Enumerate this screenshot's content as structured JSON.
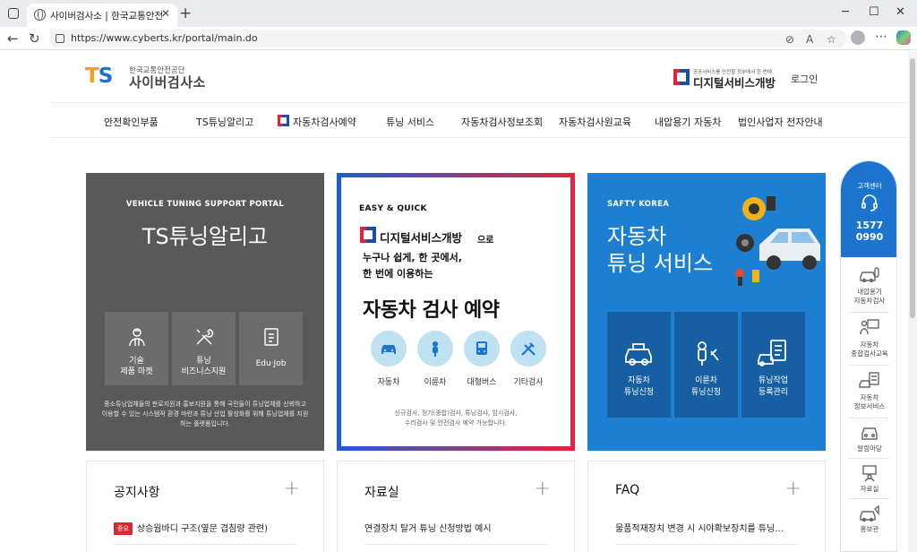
{
  "browser": {
    "tab_title": "사이버검사소 | 한국교통안전공단",
    "url": "https://www.cyberts.kr/portal/main.do"
  },
  "header": {
    "logo_mark_ts": "TS",
    "logo_sub": "한국교통안전공단",
    "logo_main": "사이버검사소",
    "digital_sub": "공공서비스를 안전할 정부에서 한 번에",
    "digital_title": "디지털서비스개방",
    "login": "로그인"
  },
  "nav": [
    "안전확인부품",
    "TS튜닝알리고",
    "자동차검사예약",
    "튜닝 서비스",
    "자동차검사정보조회",
    "자동차검사원교육",
    "내압용기 자동차",
    "법인사업자 전자안내"
  ],
  "card_tuning": {
    "eyebrow": "VEHICLE TUNING SUPPORT PORTAL",
    "title": "TS튜닝알리고",
    "tiles": [
      {
        "label1": "기술",
        "label2": "제품 마켓"
      },
      {
        "label1": "튜닝",
        "label2": "비즈니스지원"
      },
      {
        "label1": "Edu·Job",
        "label2": ""
      }
    ],
    "desc": "중소튜닝업체들의 판로지원과 홍보지원을 통해 국민들이 튜닝업체를 신뢰하고 이용할 수 있는 시스템적 환경 마련과 튜닝 산업 활성화를 위해 튜닝업체를 지원하는 플랫폼입니다."
  },
  "card_reservation": {
    "eyebrow": "EASY & QUICK",
    "brand": "디지털서비스개방",
    "brand_suffix": "으로",
    "line1": "누구나 쉽게, 한 곳에서,",
    "line2": "한 번에 이용하는",
    "title": "자동차 검사 예약",
    "icons": [
      "자동차",
      "이륜차",
      "대형버스",
      "기타검사"
    ],
    "desc1": "신규검사, 정기(종합)검사, 튜닝검사, 임시검사,",
    "desc2": "수리검사 및 안전검사 예약 가능합니다."
  },
  "card_service": {
    "eyebrow": "SAFTY KOREA",
    "title1": "자동차",
    "title2": "튜닝 서비스",
    "tiles": [
      {
        "label1": "자동차",
        "label2": "튜닝신청"
      },
      {
        "label1": "이륜차",
        "label2": "튜닝신청"
      },
      {
        "label1": "튜닝작업",
        "label2": "등록관리"
      }
    ]
  },
  "boards": [
    {
      "title": "공지사항",
      "badge": "중요",
      "item": "상승웜바디 구조(옆문 겹침량 관련)"
    },
    {
      "title": "자료실",
      "badge": "",
      "item": "연결장치 탈거 튜닝 신청방법 예시"
    },
    {
      "title": "FAQ",
      "badge": "",
      "item": "물품적재장치 변경 시 시야확보장치를 튜닝…"
    }
  ],
  "quick": {
    "label": "고객센터",
    "phone1": "1577",
    "phone2": "0990",
    "items": [
      {
        "l1": "내압용기",
        "l2": "자동차검사"
      },
      {
        "l1": "자동차",
        "l2": "종합검사교육"
      },
      {
        "l1": "자동차",
        "l2": "정보서비스"
      },
      {
        "l1": "알림마당",
        "l2": ""
      },
      {
        "l1": "자료실",
        "l2": ""
      },
      {
        "l1": "홍보관",
        "l2": ""
      }
    ]
  },
  "colors": {
    "brand_blue": "#1d7fd1",
    "brand_red": "#e5233d",
    "card_gray": "#595959"
  }
}
